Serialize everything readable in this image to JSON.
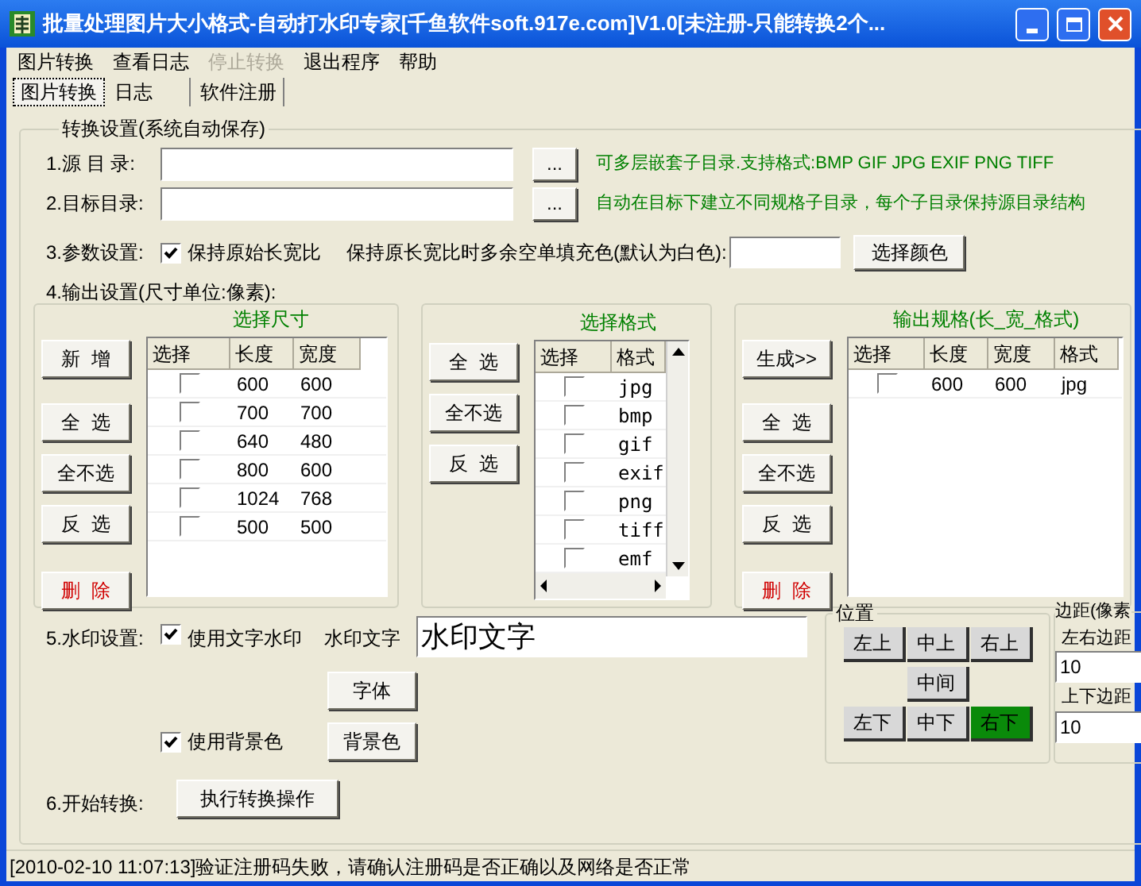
{
  "window": {
    "title": "批量处理图片大小格式-自动打水印专家[千鱼软件soft.917e.com]V1.0[未注册-只能转换2个..."
  },
  "menu": [
    {
      "label": "图片转换",
      "disabled": false
    },
    {
      "label": "查看日志",
      "disabled": false
    },
    {
      "label": "停止转换",
      "disabled": true
    },
    {
      "label": "退出程序",
      "disabled": false
    },
    {
      "label": "帮助",
      "disabled": false
    }
  ],
  "tabs": [
    {
      "label": "图片转换",
      "selected": true
    },
    {
      "label": "日志",
      "selected": false
    },
    {
      "label": "软件注册",
      "selected": false
    }
  ],
  "settings": {
    "title": "转换设置(系统自动保存)",
    "dirs": [
      {
        "label": "1.源 目 录:",
        "browse": "...",
        "hint": "可多层嵌套子目录.支持格式:BMP GIF JPG EXIF PNG TIFF"
      },
      {
        "label": "2.目标目录:",
        "browse": "...",
        "hint": "自动在目标下建立不同规格子目录，每个子目录保持源目录结构"
      }
    ],
    "params": {
      "label": "3.参数设置:",
      "keep_ratio": {
        "label": "保持原始长宽比",
        "checked": true
      },
      "fill_label": "保持原长宽比时多余空单填充色(默认为白色):",
      "color_button": "选择颜色"
    },
    "output_label": "4.输出设置(尺寸单位:像素):",
    "panels": [
      {
        "title": "选择尺寸",
        "kind": "sizes",
        "buttons": [
          {
            "label": "新  增",
            "kind": "normal"
          },
          {
            "label": "全  选",
            "kind": "normal"
          },
          {
            "label": "全不选",
            "kind": "normal"
          },
          {
            "label": "反  选",
            "kind": "normal"
          },
          {
            "label": "删  除",
            "kind": "danger"
          }
        ],
        "check_column": "选择",
        "columns": [
          "长度",
          "宽度"
        ],
        "rows": [
          {
            "checked": false,
            "cells": [
              "600",
              "600"
            ]
          },
          {
            "checked": false,
            "cells": [
              "700",
              "700"
            ]
          },
          {
            "checked": false,
            "cells": [
              "640",
              "480"
            ]
          },
          {
            "checked": false,
            "cells": [
              "800",
              "600"
            ]
          },
          {
            "checked": false,
            "cells": [
              "1024",
              "768"
            ]
          },
          {
            "checked": false,
            "cells": [
              "500",
              "500"
            ]
          }
        ]
      },
      {
        "title": "选择格式",
        "kind": "formats",
        "buttons": [
          {
            "label": "全  选",
            "kind": "normal"
          },
          {
            "label": "全不选",
            "kind": "normal"
          },
          {
            "label": "反  选",
            "kind": "normal"
          }
        ],
        "check_column": "选择",
        "columns": [
          "格式"
        ],
        "rows": [
          {
            "checked": false,
            "cells": [
              "jpg"
            ]
          },
          {
            "checked": false,
            "cells": [
              "bmp"
            ]
          },
          {
            "checked": false,
            "cells": [
              "gif"
            ]
          },
          {
            "checked": false,
            "cells": [
              "exif"
            ]
          },
          {
            "checked": false,
            "cells": [
              "png"
            ]
          },
          {
            "checked": false,
            "cells": [
              "tiff"
            ]
          },
          {
            "checked": false,
            "cells": [
              "emf"
            ]
          }
        ]
      },
      {
        "title": "输出规格(长_宽_格式)",
        "kind": "outputs",
        "buttons": [
          {
            "label": "生成>>",
            "kind": "normal"
          },
          {
            "label": "全  选",
            "kind": "normal"
          },
          {
            "label": "全不选",
            "kind": "normal"
          },
          {
            "label": "反  选",
            "kind": "normal"
          },
          {
            "label": "删  除",
            "kind": "danger"
          }
        ],
        "check_column": "选择",
        "columns": [
          "长度",
          "宽度",
          "格式"
        ],
        "rows": [
          {
            "checked": false,
            "cells": [
              "600",
              "600",
              "jpg"
            ]
          }
        ]
      }
    ],
    "watermark": {
      "label": "5.水印设置:",
      "use_text": {
        "label": "使用文字水印",
        "checked": true
      },
      "text_label": "水印文字",
      "text_value": "水印文字",
      "font_button": "字体",
      "use_bg": {
        "label": "使用背景色",
        "checked": true
      },
      "bg_button": "背景色"
    },
    "position": {
      "title": "位置",
      "top": [
        {
          "label": "左上",
          "selected": false
        },
        {
          "label": "中上",
          "selected": false
        },
        {
          "label": "右上",
          "selected": false
        }
      ],
      "middle": {
        "label": "中间",
        "selected": false
      },
      "bottom": [
        {
          "label": "左下",
          "selected": false
        },
        {
          "label": "中下",
          "selected": false
        },
        {
          "label": "右下",
          "selected": true
        }
      ]
    },
    "margins": {
      "title": "边距(像素",
      "horizontal_label": "左右边距",
      "horizontal_value": "10",
      "vertical_label": "上下边距",
      "vertical_value": "10"
    },
    "start": {
      "label": "6.开始转换:",
      "button": "执行转换操作"
    }
  },
  "status_bar": "[2010-02-10 11:07:13]验证注册码失败，请确认注册码是否正确以及网络是否正常"
}
